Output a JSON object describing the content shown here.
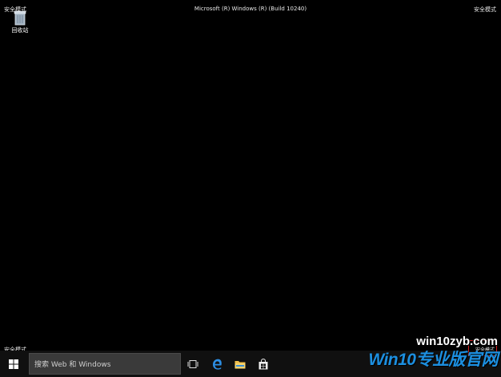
{
  "desktop": {
    "safe_mode_label": "安全模式",
    "build_string": "Microsoft (R) Windows (R) (Build 10240)",
    "recycle_bin_label": "回收站",
    "recycle_bin_icon": "recycle-bin-icon"
  },
  "taskbar": {
    "start_icon": "windows-logo-icon",
    "search_placeholder": "搜索 Web 和 Windows",
    "pinned": [
      "task-view-icon",
      "edge-icon",
      "file-explorer-icon",
      "store-icon"
    ]
  },
  "watermark": {
    "site": "win10zyb.com",
    "brand": "Win10专业版官网"
  },
  "colors": {
    "desktop_bg": "#000000",
    "taskbar_bg": "#101010",
    "highlight": "#d01f1f",
    "watermark_blue": "#1c8fe0"
  }
}
